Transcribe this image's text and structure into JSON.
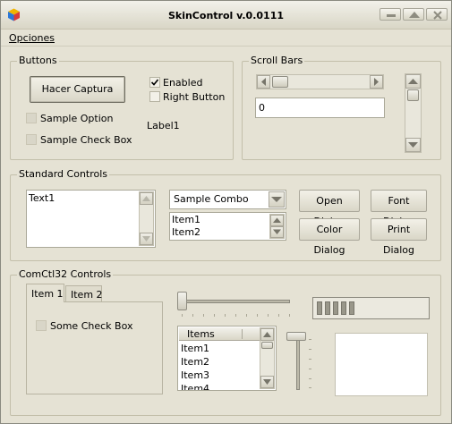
{
  "window": {
    "title": "SkinControl v.0.0111"
  },
  "menu": {
    "opciones": "Opciones"
  },
  "buttons_group": {
    "legend": "Buttons",
    "capture_button": "Hacer Captura",
    "enabled_label": "Enabled",
    "right_button_label": "Right Button",
    "sample_option_label": "Sample Option",
    "sample_check_box_label": "Sample Check Box",
    "label1": "Label1"
  },
  "scroll_group": {
    "legend": "Scroll Bars",
    "value": "0"
  },
  "standard_group": {
    "legend": "Standard Controls",
    "text1": "Text1",
    "combo_value": "Sample Combo",
    "list_items": [
      "Item1",
      "Item2"
    ],
    "open_dialog": "Open Dialog",
    "font_dialog": "Font Dialog",
    "color_dialog": "Color Dialog",
    "print_dialog": "Print Dialog"
  },
  "comctl_group": {
    "legend": "ComCtl32 Controls",
    "tabs": [
      "Item 1",
      "Item 2"
    ],
    "some_check_box": "Some Check Box",
    "listview_header": "Items",
    "listview_items": [
      "Item1",
      "Item2",
      "Item3",
      "Item4"
    ],
    "progress_segments": 5,
    "progress_max": 11
  },
  "colors": {
    "window_bg": "#e5e2d4",
    "desktop_bg": "#9aa3ad"
  },
  "icons": [
    "app-icon",
    "minimize-icon",
    "restore-icon",
    "close-icon",
    "checkmark-icon",
    "arrow-left-icon",
    "arrow-right-icon",
    "arrow-up-icon",
    "arrow-down-icon",
    "combo-dropdown-icon"
  ]
}
